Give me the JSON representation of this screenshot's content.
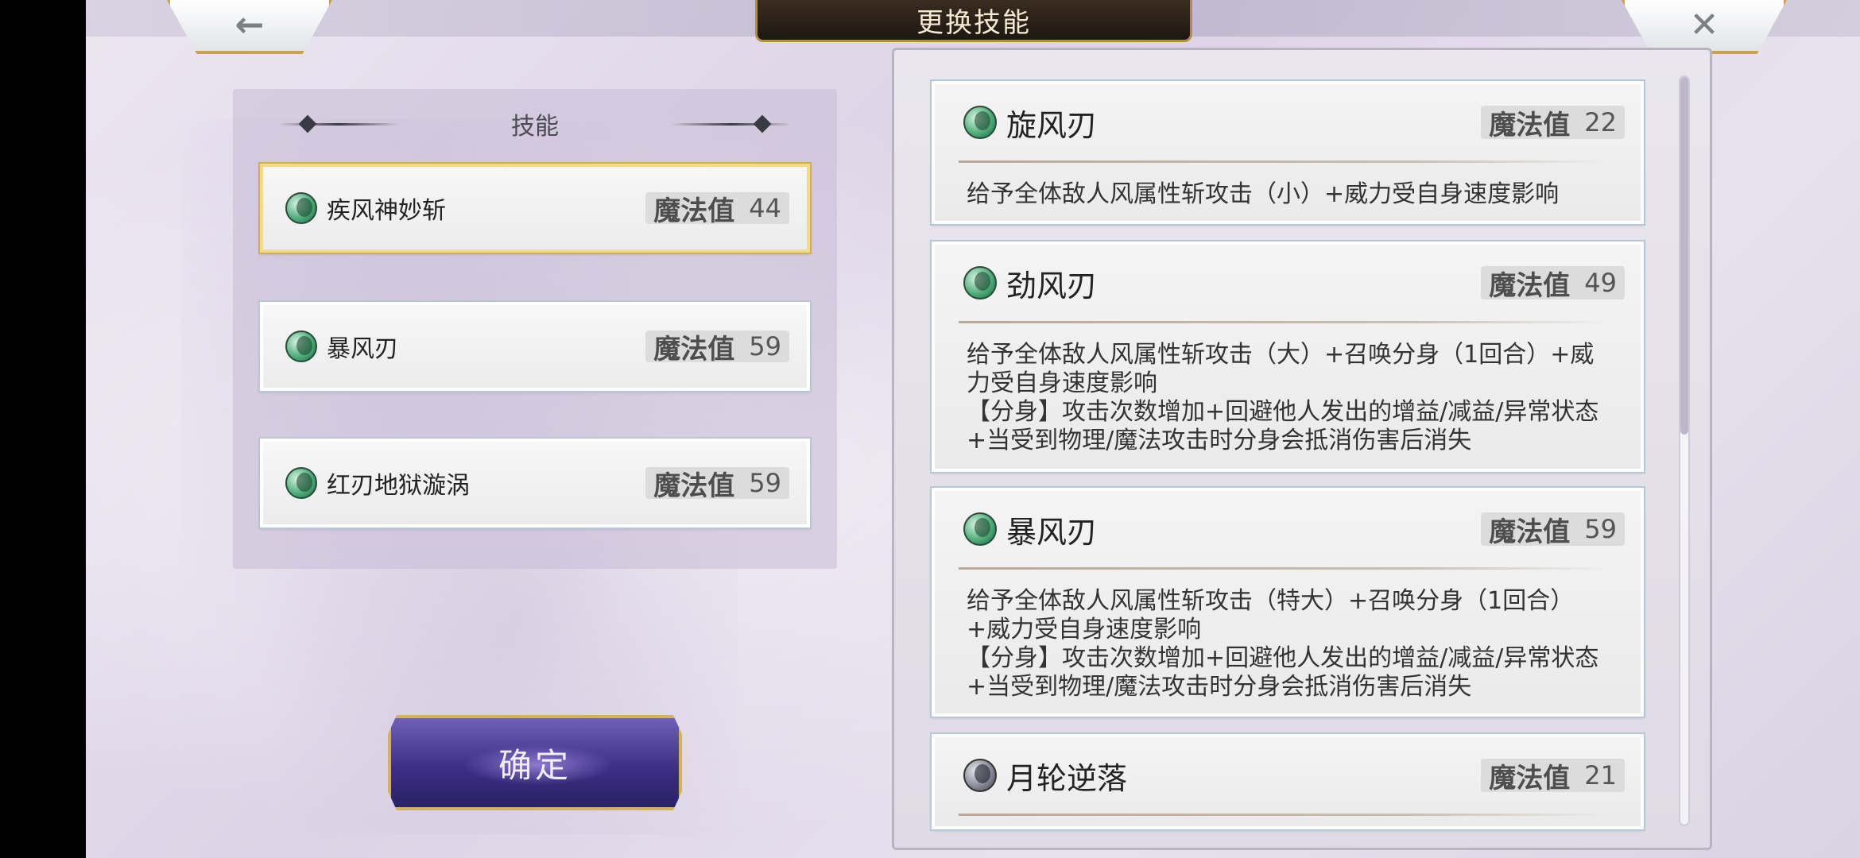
{
  "header": {
    "title": "更换技能"
  },
  "nav": {
    "back_glyph": "🡐",
    "close_glyph": "✕"
  },
  "left_panel": {
    "title": "技能",
    "slots": [
      {
        "name": "疾风神妙斩",
        "mp_label": "魔法值",
        "mp": "44",
        "selected": true,
        "icon": "wind-orb-icon"
      },
      {
        "name": "暴风刃",
        "mp_label": "魔法值",
        "mp": "59",
        "selected": false,
        "icon": "wind-orb-icon"
      },
      {
        "name": "红刃地狱漩涡",
        "mp_label": "魔法值",
        "mp": "59",
        "selected": false,
        "icon": "wind-orb-icon"
      }
    ]
  },
  "confirm": {
    "label": "确定"
  },
  "skill_list": [
    {
      "name": "旋风刃",
      "mp_label": "魔法值",
      "mp": "22",
      "icon": "wind-orb-icon",
      "desc": [
        "给予全体敌人风属性斩攻击（小）+威力受自身速度影响"
      ]
    },
    {
      "name": "劲风刃",
      "mp_label": "魔法值",
      "mp": "49",
      "icon": "wind-orb-icon",
      "desc": [
        "给予全体敌人风属性斩攻击（大）+召唤分身（1回合）+威力受自身速度影响",
        "【分身】攻击次数增加+回避他人发出的增益/减益/异常状态+当受到物理/魔法攻击时分身会抵消伤害后消失"
      ]
    },
    {
      "name": "暴风刃",
      "mp_label": "魔法值",
      "mp": "59",
      "icon": "wind-orb-icon",
      "desc": [
        "给予全体敌人风属性斩攻击（特大）+召唤分身（1回合）+威力受自身速度影响",
        "【分身】攻击次数增加+回避他人发出的增益/减益/异常状态+当受到物理/魔法攻击时分身会抵消伤害后消失"
      ]
    },
    {
      "name": "月轮逆落",
      "mp_label": "魔法值",
      "mp": "21",
      "icon": "moon-orb-icon",
      "desc": []
    }
  ],
  "colors": {
    "accent_gold": "#d4b25d",
    "confirm_purple": "#3d2f86",
    "wind_green": "#4fae7c"
  }
}
